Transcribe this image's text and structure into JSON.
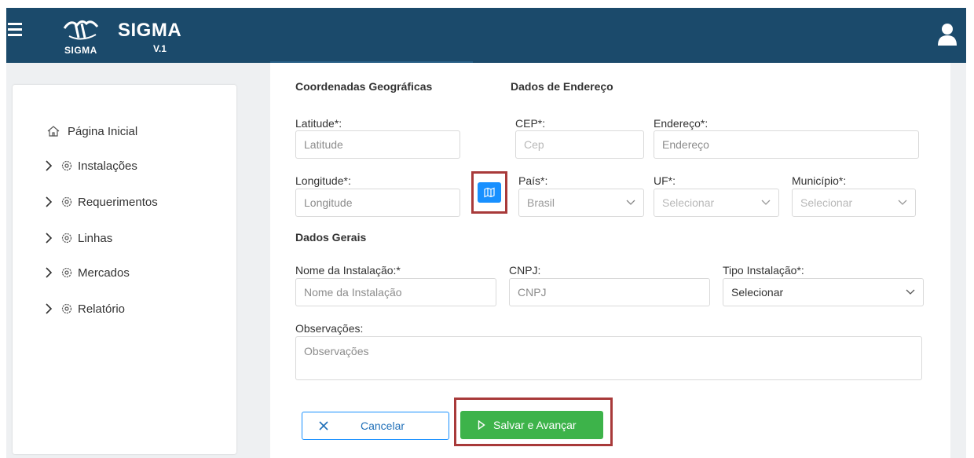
{
  "header": {
    "title": "SIGMA",
    "version": "V.1",
    "logo_text": "SIGMA",
    "bar_color": "#1b4a6b"
  },
  "sidebar": {
    "items": [
      {
        "label": "Página Inicial",
        "icon": "home-icon"
      },
      {
        "label": "Instalações",
        "icon": "gear-icon"
      },
      {
        "label": "Requerimentos",
        "icon": "gear-icon"
      },
      {
        "label": "Linhas",
        "icon": "gear-icon"
      },
      {
        "label": "Mercados",
        "icon": "gear-icon"
      },
      {
        "label": "Relatório",
        "icon": "gear-icon"
      }
    ]
  },
  "form": {
    "geo_title": "Coordenadas Geográficas",
    "address_title": "Dados de Endereço",
    "general_title": "Dados Gerais",
    "latitude": {
      "label": "Latitude*:",
      "placeholder": "Latitude"
    },
    "longitude": {
      "label": "Longitude*:",
      "placeholder": "Longitude"
    },
    "cep": {
      "label": "CEP*:",
      "placeholder": "Cep"
    },
    "endereco": {
      "label": "Endereço*:",
      "placeholder": "Endereço"
    },
    "pais": {
      "label": "País*:",
      "value": "Brasil"
    },
    "uf": {
      "label": "UF*:",
      "value": "Selecionar"
    },
    "municipio": {
      "label": "Município*:",
      "value": "Selecionar"
    },
    "nome": {
      "label": "Nome da Instalação:*",
      "placeholder": "Nome da Instalação"
    },
    "cnpj": {
      "label": "CNPJ:",
      "placeholder": "CNPJ"
    },
    "tipo": {
      "label": "Tipo Instalação*:",
      "value": "Selecionar"
    },
    "observacoes": {
      "label": "Observações:",
      "placeholder": "Observações"
    }
  },
  "actions": {
    "cancel_label": "Cancelar",
    "save_label": "Salvar e Avançar",
    "save_color": "#3db34a",
    "primary_color": "#1890ff",
    "highlight_color": "#a83a3a"
  }
}
